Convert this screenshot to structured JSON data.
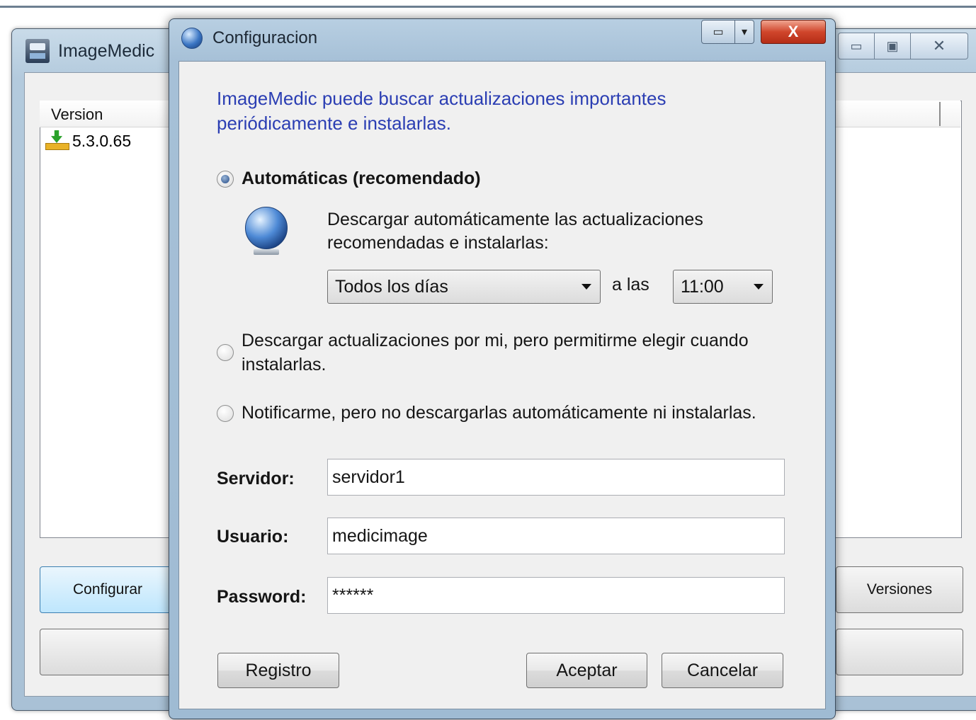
{
  "background_window": {
    "title": "ImageMedic",
    "controls": {
      "minimize": "▭",
      "maximize": "▣",
      "close": "✕"
    },
    "list": {
      "column_header": "Version",
      "rows": [
        {
          "version": "5.3.0.65",
          "icon": "download-icon"
        }
      ]
    },
    "buttons": {
      "configurar": "Configurar",
      "versiones": "Versiones",
      "blank_left": "",
      "blank_right": ""
    }
  },
  "dialog": {
    "title": "Configuracion",
    "intro": "ImageMedic puede buscar actualizaciones importantes periódicamente e instalarlas.",
    "options": [
      {
        "label": "Automáticas (recomendado)",
        "selected": true
      },
      {
        "label": "Descargar actualizaciones por mi, pero permitirme elegir cuando instalarlas.",
        "selected": false
      },
      {
        "label": "Notificarme, pero no descargarlas automáticamente ni instalarlas.",
        "selected": false
      }
    ],
    "auto_description": "Descargar automáticamente las actualizaciones recomendadas e instalarlas:",
    "frequency": {
      "value": "Todos los días"
    },
    "at_label": "a las",
    "time": {
      "value": "11:00"
    },
    "fields": {
      "servidor": {
        "label": "Servidor:",
        "value": "servidor1"
      },
      "usuario": {
        "label": "Usuario:",
        "value": "medicimage"
      },
      "password": {
        "label": "Password:",
        "value": "******"
      }
    },
    "buttons": {
      "registro": "Registro",
      "aceptar": "Aceptar",
      "cancelar": "Cancelar"
    },
    "close_label": "X"
  }
}
